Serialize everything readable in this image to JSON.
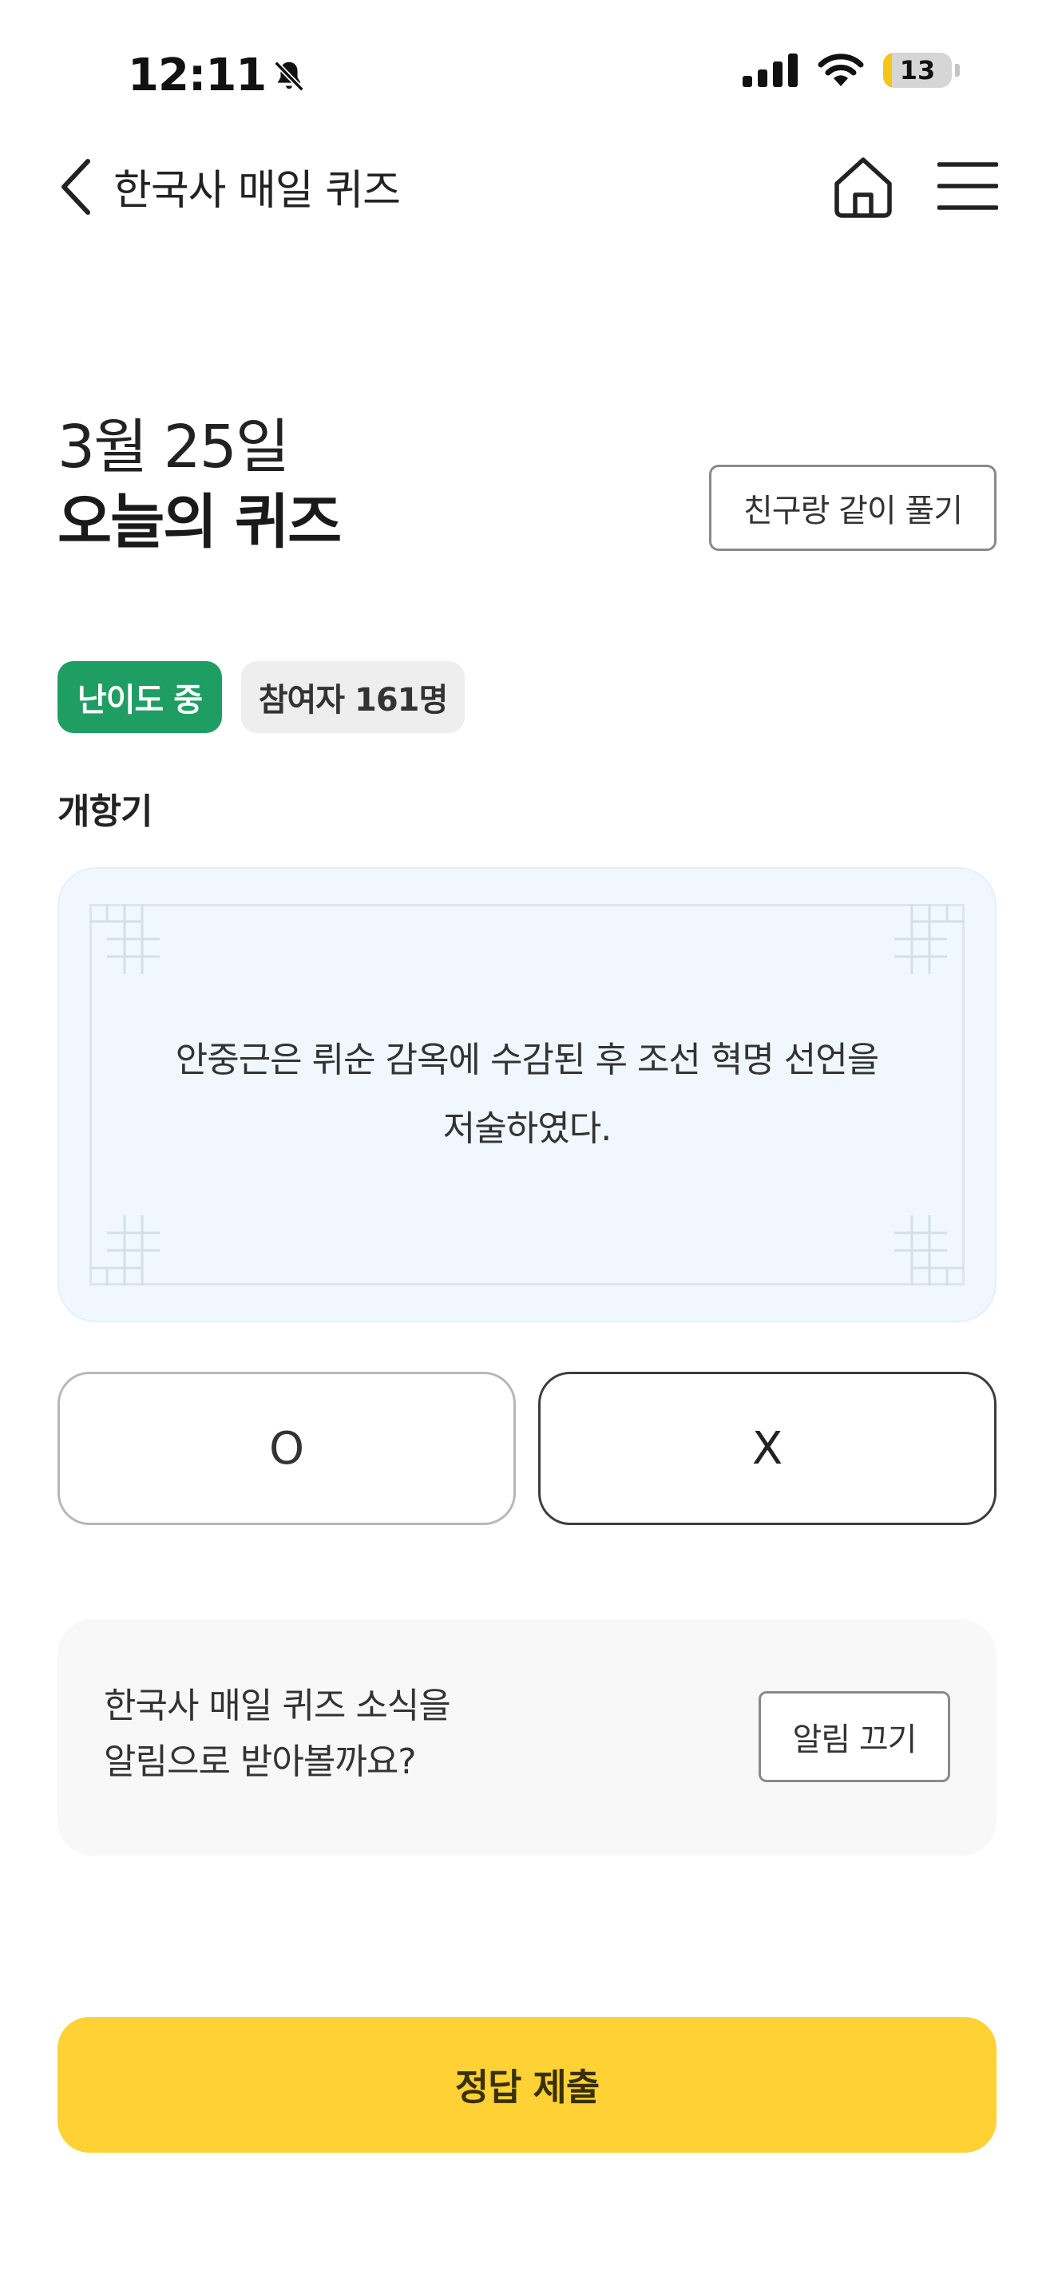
{
  "status_bar": {
    "time": "12:11",
    "battery": "13",
    "battery_level": 0.13,
    "icons": [
      "bell-slash-icon",
      "cellular-signal-icon",
      "wifi-icon",
      "battery-icon"
    ]
  },
  "header": {
    "title": "한국사 매일 퀴즈",
    "icons": [
      "back-chevron-icon",
      "home-icon",
      "menu-icon"
    ]
  },
  "quiz": {
    "date": "3월 25일",
    "title": "오늘의 퀴즈",
    "friend_button": "친구랑 같이 풀기",
    "difficulty_badge": "난이도 중",
    "participants_badge": "참여자 161명",
    "category": "개항기",
    "question_line1": "안중근은 뤼순 감옥에 수감된 후 조선 혁명 선언을",
    "question_line2": "저술하였다.",
    "answer_o": "O",
    "answer_x": "X"
  },
  "notification": {
    "line1": "한국사 매일 퀴즈 소식을",
    "line2": "알림으로 받아볼까요?",
    "button": "알림 끄기"
  },
  "submit": {
    "label": "정답 제출"
  },
  "colors": {
    "accent_yellow": "#fed235",
    "difficulty_green": "#1f9e63",
    "card_background": "#f0f7fe",
    "battery_yellow": "#f5c518"
  }
}
